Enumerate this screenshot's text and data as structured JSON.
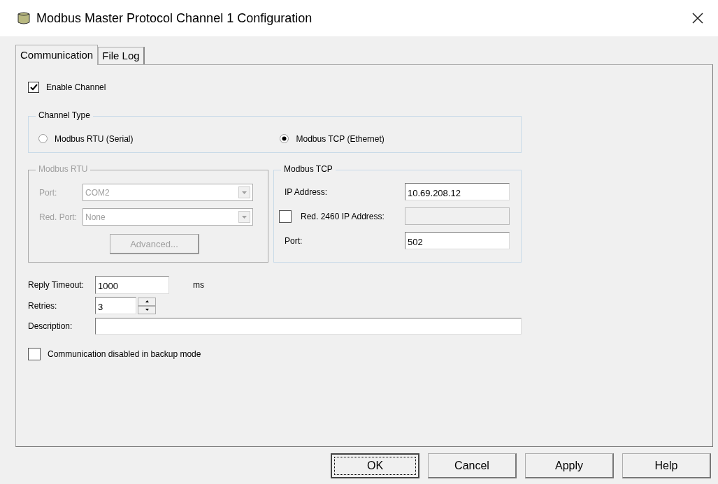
{
  "window": {
    "title": "Modbus Master Protocol Channel 1 Configuration"
  },
  "tabs": [
    {
      "label": "Communication",
      "selected": true
    },
    {
      "label": "File Log",
      "selected": false
    }
  ],
  "enable_channel": {
    "label": "Enable Channel",
    "checked": true
  },
  "channel_type": {
    "legend": "Channel Type",
    "options": [
      {
        "label": "Modbus RTU (Serial)",
        "selected": false
      },
      {
        "label": "Modbus TCP (Ethernet)",
        "selected": true
      }
    ]
  },
  "modbus_rtu": {
    "legend": "Modbus RTU",
    "disabled": true,
    "port": {
      "label": "Port:",
      "value": "COM2"
    },
    "red_port": {
      "label": "Red. Port:",
      "value": "None"
    },
    "advanced_button": "Advanced..."
  },
  "modbus_tcp": {
    "legend": "Modbus TCP",
    "ip_address": {
      "label": "IP Address:",
      "value": "10.69.208.12"
    },
    "red_ip": {
      "label": "Red. 2460 IP Address:",
      "checked": false,
      "disabled": true
    },
    "port": {
      "label": "Port:",
      "value": "502"
    }
  },
  "reply_timeout": {
    "label": "Reply Timeout:",
    "value": "1000",
    "unit": "ms"
  },
  "retries": {
    "label": "Retries:",
    "value": "3"
  },
  "description": {
    "label": "Description:"
  },
  "backup_mode": {
    "label": "Communication disabled in backup mode",
    "checked": false
  },
  "buttons": [
    {
      "label": "OK",
      "default": true
    },
    {
      "label": "Cancel",
      "default": false
    },
    {
      "label": "Apply",
      "default": false
    },
    {
      "label": "Help",
      "default": false
    }
  ]
}
